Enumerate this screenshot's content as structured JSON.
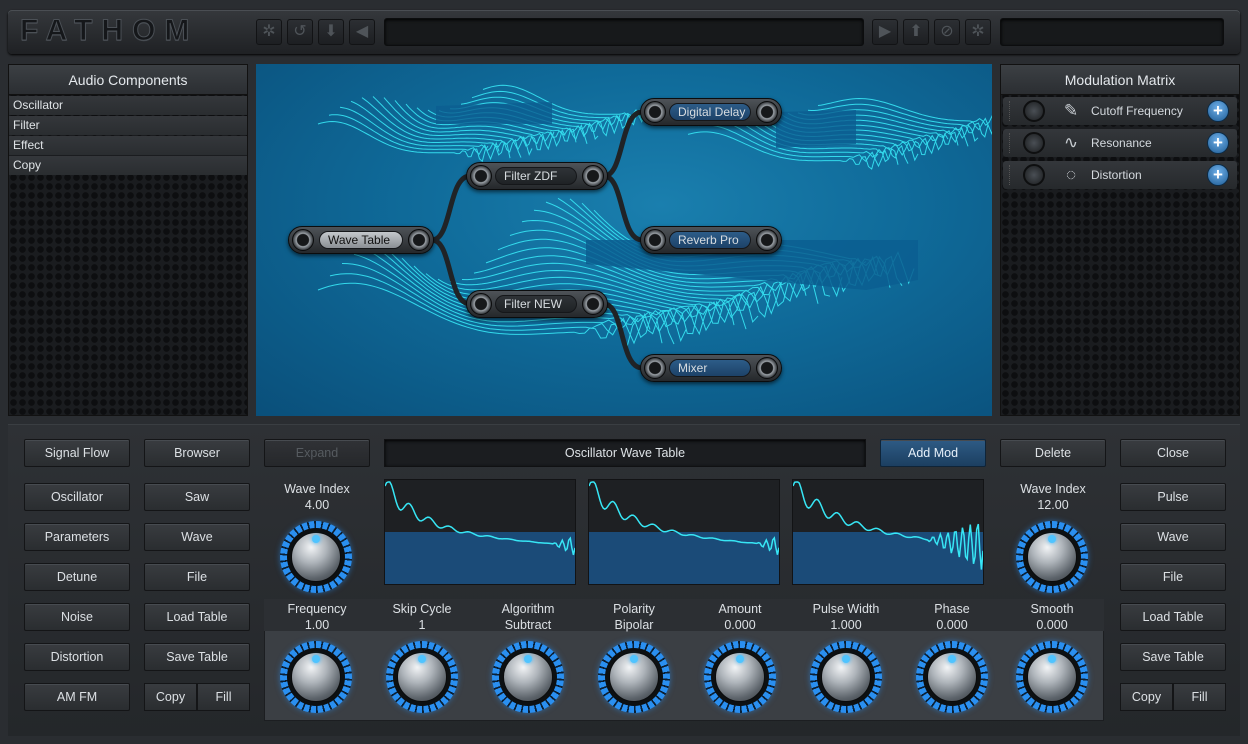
{
  "app": {
    "logo": "FATHOM"
  },
  "toolbar": {
    "left_icons": [
      "gear-icon",
      "undo-icon",
      "download-icon",
      "arrow-left-icon"
    ],
    "right_icons": [
      "arrow-right-icon",
      "upload-icon",
      "cancel-icon",
      "gear-icon"
    ],
    "left_glyphs": [
      "✲",
      "↺",
      "⬇",
      "◀"
    ],
    "right_glyphs": [
      "▶",
      "⬆",
      "⊘",
      "✲"
    ]
  },
  "audio_components": {
    "title": "Audio Components",
    "items": [
      "Oscillator",
      "Filter",
      "Effect",
      "Copy"
    ]
  },
  "modulation_matrix": {
    "title": "Modulation Matrix",
    "rows": [
      {
        "label": "Cutoff Frequency",
        "icon": "pencil-icon",
        "glyph": "✎"
      },
      {
        "label": "Resonance",
        "icon": "sine-wave-icon",
        "glyph": "∿"
      },
      {
        "label": "Distortion",
        "icon": "dial-icon",
        "glyph": "◌"
      }
    ]
  },
  "signal_flow": {
    "nodes": {
      "wave_table": "Wave Table",
      "filter_zdf": "Filter ZDF",
      "filter_new": "Filter NEW",
      "digital_delay": "Digital Delay",
      "reverb_pro": "Reverb Pro",
      "mixer": "Mixer"
    }
  },
  "editor": {
    "left_col1": [
      "Signal Flow",
      "Oscillator",
      "Parameters",
      "Detune",
      "Noise",
      "Distortion",
      "AM FM"
    ],
    "left_col2": [
      "Browser",
      "Saw",
      "Wave",
      "File",
      "Load Table",
      "Save Table"
    ],
    "left_copy": "Copy",
    "left_fill": "Fill",
    "expand": "Expand",
    "title": "Oscillator Wave Table",
    "add_mod": "Add Mod",
    "delete": "Delete",
    "close": "Close",
    "right_col": [
      "Pulse",
      "Wave",
      "File",
      "Load Table",
      "Save Table"
    ],
    "right_copy": "Copy",
    "right_fill": "Fill",
    "wave_index_left": {
      "label": "Wave Index",
      "value": "4.00"
    },
    "wave_index_right": {
      "label": "Wave Index",
      "value": "12.00"
    },
    "params": [
      {
        "label": "Frequency",
        "value": "1.00"
      },
      {
        "label": "Skip Cycle",
        "value": "1"
      },
      {
        "label": "Algorithm",
        "value": "Subtract"
      },
      {
        "label": "Polarity",
        "value": "Bipolar"
      },
      {
        "label": "Amount",
        "value": "0.000"
      },
      {
        "label": "Pulse Width",
        "value": "1.000"
      },
      {
        "label": "Phase",
        "value": "0.000"
      },
      {
        "label": "Smooth",
        "value": "0.000"
      }
    ]
  },
  "colors": {
    "accent": "#2a8ff0",
    "wave": "#37e6f5",
    "canvas": "#0f6a99"
  }
}
